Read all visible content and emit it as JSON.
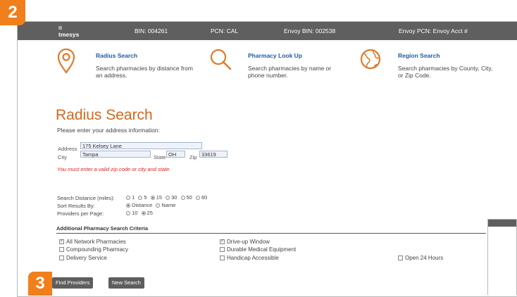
{
  "badges": {
    "step2": "2",
    "step3": "3"
  },
  "topbar": {
    "brand": "tmesys",
    "brand_mark": "®",
    "bin": "BIN: 004261",
    "pcn": "PCN: CAL",
    "envoy_bin": "Envoy BIN: 002538",
    "envoy_pcn": "Envoy PCN: Envoy Acct #"
  },
  "tools": [
    {
      "icon": "location-pin-icon",
      "title": "Radius Search",
      "desc": "Search pharmacies by distance from an address."
    },
    {
      "icon": "magnifier-icon",
      "title": "Pharmacy Look Up",
      "desc": "Search pharmacies by name or phone number."
    },
    {
      "icon": "globe-icon",
      "title": "Region Search",
      "desc": "Search pharmacies by County, City, or Zip Code."
    }
  ],
  "form": {
    "heading": "Radius Search",
    "intro": "Please enter your address information:",
    "address_label": "Address",
    "address_value": "175 Kelsey Lane",
    "city_label": "City",
    "city_value": "Tampa",
    "state_label": "State",
    "state_value": "OH",
    "zip_label": "Zip",
    "zip_value": "33619",
    "error": "You must enter a valid zip code or city and state.",
    "distance_label": "Search Distance (miles):",
    "distance_options": [
      "1",
      "5",
      "15",
      "30",
      "50",
      "60"
    ],
    "distance_selected": "15",
    "sort_label": "Sort Results By:",
    "sort_options": [
      "Distance",
      "Name"
    ],
    "sort_selected": "Distance",
    "per_page_label": "Providers per Page:",
    "per_page_options": [
      "10",
      "25"
    ],
    "per_page_selected": "25"
  },
  "criteria": {
    "title": "Additional Pharmacy Search Criteria",
    "items": [
      {
        "label": "All Network Pharmacies",
        "checked": true
      },
      {
        "label": "Compounding Pharmacy",
        "checked": false
      },
      {
        "label": "Delivery Service",
        "checked": false
      },
      {
        "label": "Drive-up Window",
        "checked": true
      },
      {
        "label": "Durable Medical Equipment",
        "checked": false
      },
      {
        "label": "Handicap Accessible",
        "checked": false
      },
      {
        "label": "Open 24 Hours",
        "checked": false
      }
    ]
  },
  "buttons": {
    "find": "Find Providers",
    "new": "New Search"
  },
  "colors": {
    "accent": "#f07f1c",
    "bar": "#5f5f5f",
    "link": "#1e5aa8",
    "heading": "#d4661c",
    "error": "#e02020"
  }
}
